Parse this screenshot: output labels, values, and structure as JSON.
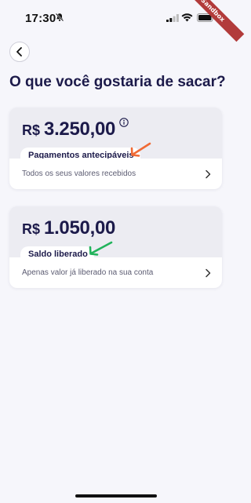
{
  "status_bar": {
    "time": "17:30",
    "ribbon": "Sandbox"
  },
  "title": "O que você gostaria de sacar?",
  "cards": [
    {
      "currency": "R$",
      "amount": "3.250,00",
      "label": "Pagamentos antecipáveis",
      "footer": "Todos os seus valores recebidos",
      "arrow_color": "#f06a35"
    },
    {
      "currency": "R$",
      "amount": "1.050,00",
      "label": "Saldo liberado",
      "footer": "Apenas valor já liberado na sua conta",
      "arrow_color": "#22b35c"
    }
  ],
  "colors": {
    "background": "#f6f6fb",
    "primary_text": "#1c1a4a",
    "card_header": "#ececf2"
  }
}
